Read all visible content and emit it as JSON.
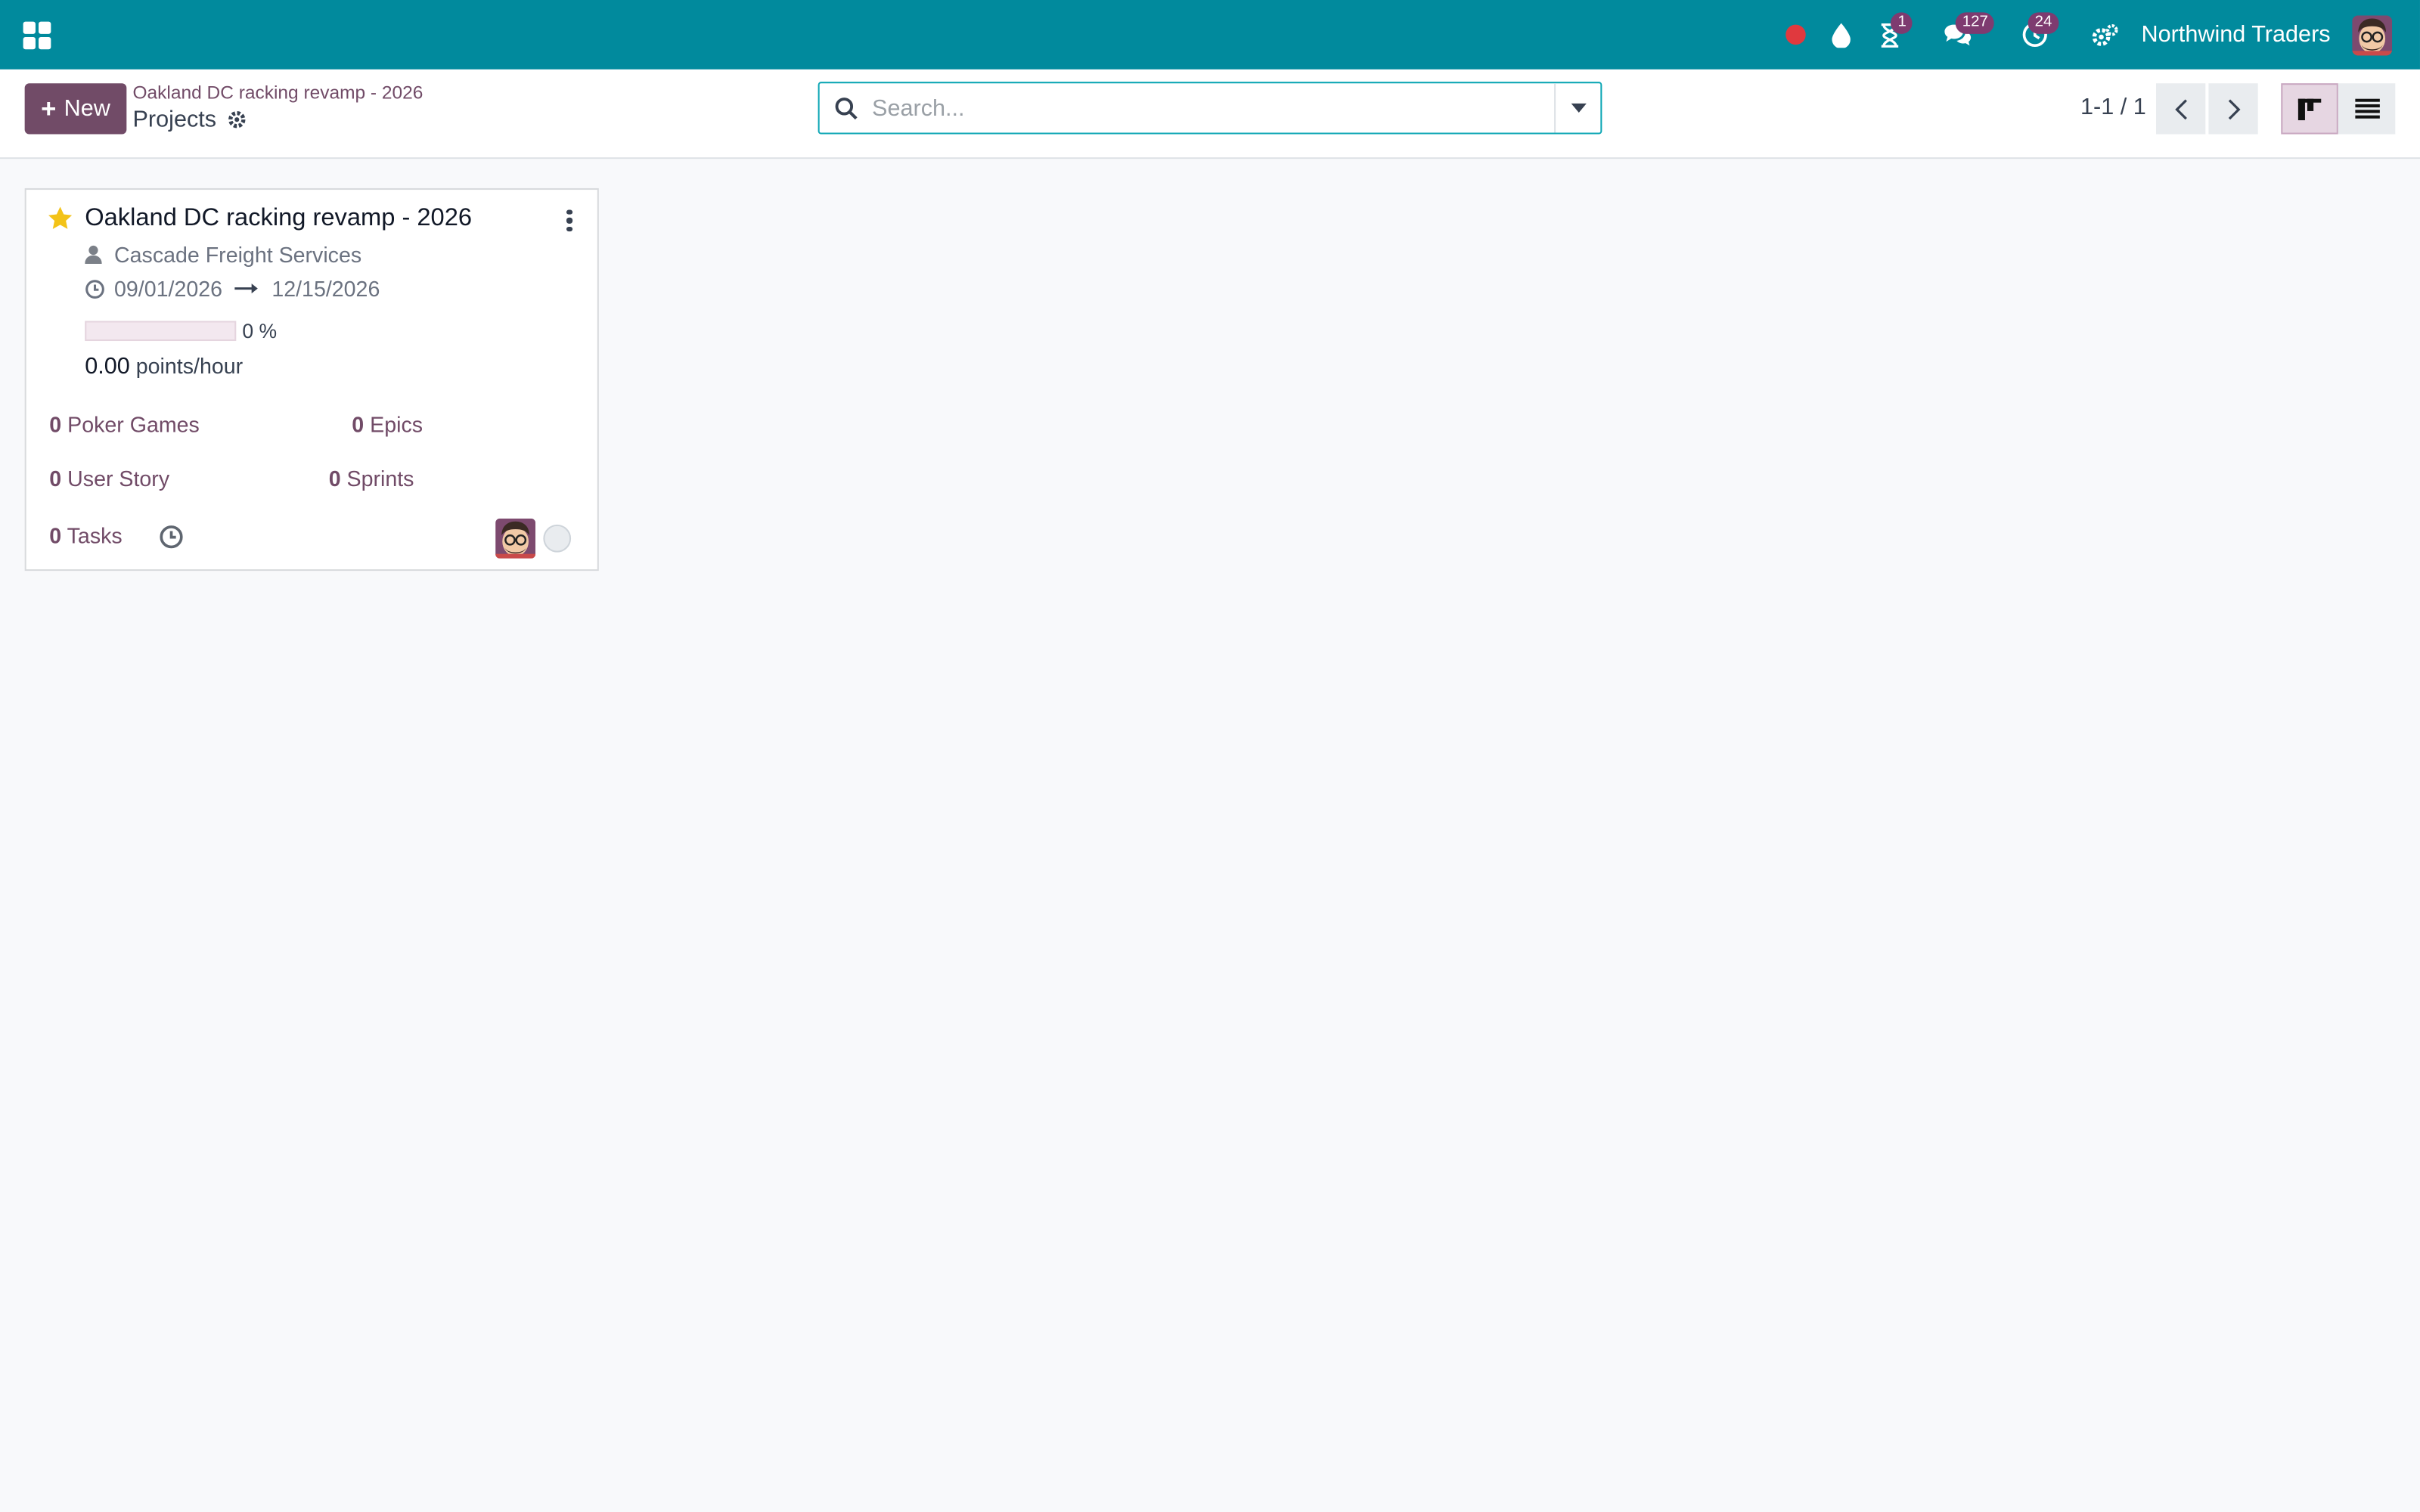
{
  "topnav": {
    "company_name": "Northwind Traders",
    "badges": {
      "activities_hourglass": "1",
      "messages": "127",
      "timesheets": "24"
    },
    "colors": {
      "bar": "#018a9d",
      "badge": "#7e3b70",
      "record": "#e0393e"
    }
  },
  "control": {
    "new_label": "New",
    "breadcrumb_parent": "Oakland DC racking revamp - 2026",
    "breadcrumb_current": "Projects",
    "search_placeholder": "Search...",
    "pager_value": "1-1 / 1",
    "active_view": "kanban"
  },
  "card": {
    "title": "Oakland DC racking revamp - 2026",
    "favorite": true,
    "customer": "Cascade Freight Services",
    "date_start": "09/01/2026",
    "date_end": "12/15/2026",
    "progress_percent": 0,
    "progress_label": "0 %",
    "velocity_value": "0.00",
    "velocity_unit": "points/hour",
    "stats": {
      "poker_games": {
        "count": "0",
        "label": "Poker Games"
      },
      "epics": {
        "count": "0",
        "label": "Epics"
      },
      "user_story": {
        "count": "0",
        "label": "User Story"
      },
      "sprints": {
        "count": "0",
        "label": "Sprints"
      },
      "tasks": {
        "count": "0",
        "label": "Tasks"
      }
    }
  }
}
